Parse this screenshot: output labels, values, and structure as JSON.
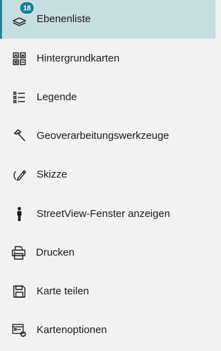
{
  "menu": {
    "accent_color": "#1b8596",
    "active_background": "#c5dfe0",
    "badge_color": "#1b7f91",
    "items": [
      {
        "label": "Ebenenliste",
        "icon": "layers-icon",
        "badge": "18",
        "active": true
      },
      {
        "label": "Hintergrundkarten",
        "icon": "basemap-grid-icon"
      },
      {
        "label": "Legende",
        "icon": "legend-list-icon"
      },
      {
        "label": "Geoverarbeitungswerkzeuge",
        "icon": "hammer-icon"
      },
      {
        "label": "Skizze",
        "icon": "sketch-pencil-icon"
      },
      {
        "label": "StreetView-Fenster anzeigen",
        "icon": "person-icon"
      },
      {
        "label": "Drucken",
        "icon": "printer-icon"
      },
      {
        "label": "Karte teilen",
        "icon": "save-disk-icon"
      },
      {
        "label": "Kartenoptionen",
        "icon": "map-settings-icon"
      }
    ]
  }
}
